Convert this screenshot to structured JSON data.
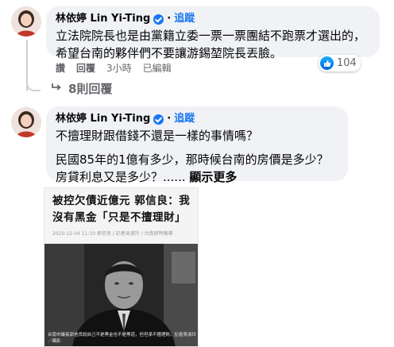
{
  "comment1": {
    "author": "林依婷 Lin Yi-Ting",
    "separator": "·",
    "follow_label": "追蹤",
    "text": "立法院院長也是由黨籍立委一票一票團結不跑票才選出的，希望台南的夥伴們不要讓游錫堃院長丟臉。",
    "actions": {
      "like": "讚",
      "reply": "回覆",
      "time": "3小時",
      "edited": "已編輯"
    },
    "reaction_count": "104",
    "replies_label": "8則回覆"
  },
  "comment2": {
    "author": "林依婷 Lin Yi-Ting",
    "separator": "·",
    "follow_label": "追蹤",
    "text_line1": "不擅理財跟借錢不還是一樣的事情嗎？",
    "text_para2": "民國85年的1億有多少，那時候台南的房價是多少？房貸利息又是多少？......",
    "see_more": "顯示更多"
  },
  "news_image": {
    "headline": "被控欠債近億元 郭信良：我沒有黑金「只是不擅理財」",
    "meta": "2020-12-04 11:10   郭信良 | 記者吳淑玲 / 台南即時報導",
    "caption": "台南市議長郭信良說自己不是黑金也不是黑道，但坦承不擅理財。記者吳淑玲／攝影"
  },
  "icons": {
    "like": "like-thumb-icon",
    "verified": "verified-badge-icon",
    "reply_arrow": "reply-arrow-icon"
  },
  "colors": {
    "bubble": "#f0f2f5",
    "accent": "#1877f2",
    "muted": "#65676b"
  }
}
